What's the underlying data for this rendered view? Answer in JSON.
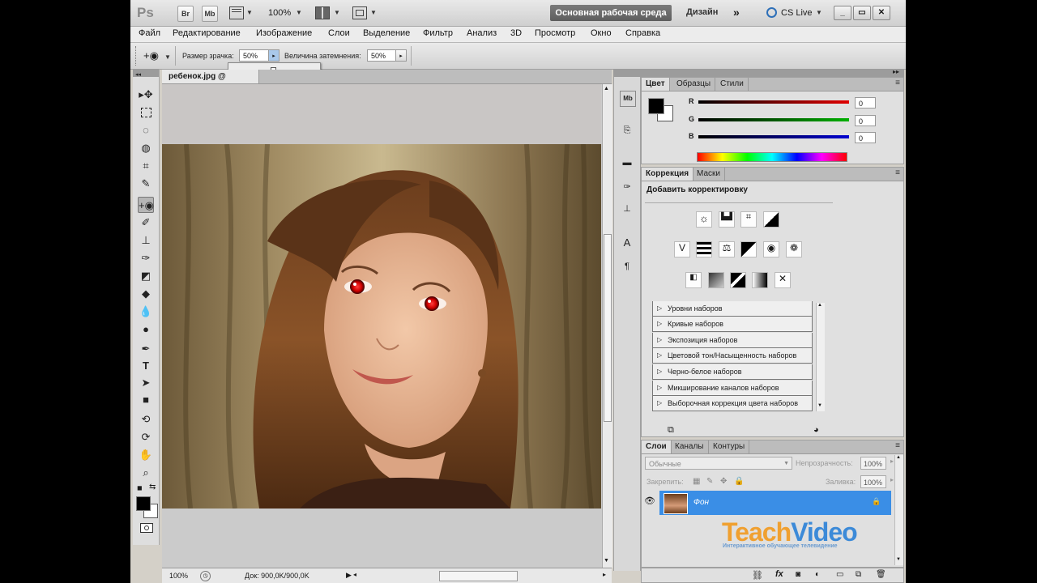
{
  "app": {
    "logo": "Ps",
    "buttons": {
      "bridge": "Br",
      "mini_bridge": "Mb"
    },
    "zoom": "100%",
    "workspace": "Основная рабочая среда",
    "design": "Дизайн",
    "more": "»",
    "cslive": "CS Live"
  },
  "menu": [
    "Файл",
    "Редактирование",
    "Изображение",
    "Слои",
    "Выделение",
    "Фильтр",
    "Анализ",
    "3D",
    "Просмотр",
    "Окно",
    "Справка"
  ],
  "options": {
    "pupil_label": "Размер зрачка:",
    "pupil_value": "50%",
    "darken_label": "Величина затемнения:",
    "darken_value": "50%",
    "slider_value": 0.5
  },
  "document": {
    "tab": "ребенок.jpg @",
    "zoom": "100%",
    "doc_info": "Док: 900,0K/900,0K"
  },
  "color_panel": {
    "tabs": [
      "Цвет",
      "Образцы",
      "Стили"
    ],
    "channels": [
      {
        "label": "R",
        "value": "0",
        "color": "#e00000"
      },
      {
        "label": "G",
        "value": "0",
        "color": "#00b000"
      },
      {
        "label": "B",
        "value": "0",
        "color": "#0000d0"
      }
    ]
  },
  "adjust_panel": {
    "tabs": [
      "Коррекция",
      "Маски"
    ],
    "heading": "Добавить корректировку",
    "presets": [
      "Уровни наборов",
      "Кривые наборов",
      "Экспозиция наборов",
      "Цветовой тон/Насыщенность наборов",
      "Черно-белое наборов",
      "Микширование каналов наборов",
      "Выборочная коррекция цвета наборов"
    ]
  },
  "layers_panel": {
    "tabs": [
      "Слои",
      "Каналы",
      "Контуры"
    ],
    "blend_mode": "Обычные",
    "opacity_label": "Непрозрачность:",
    "opacity_value": "100%",
    "lock_label": "Закрепить:",
    "fill_label": "Заливка:",
    "fill_value": "100%",
    "layer_name": "Фон"
  },
  "watermark": {
    "teach": "Teach",
    "video": "Video",
    "tagline": "Интерактивное обучающее телевидение"
  }
}
